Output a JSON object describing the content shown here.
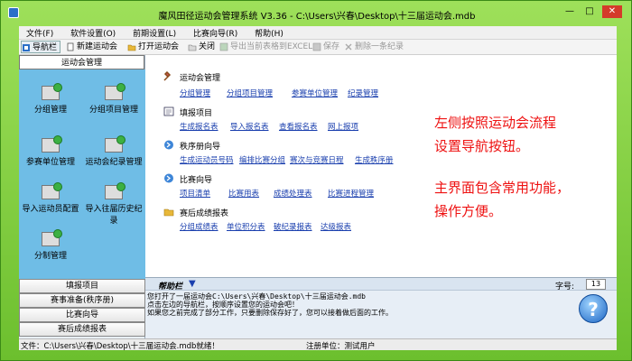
{
  "window": {
    "title": "魔风田径运动会管理系统 V3.36 - C:\\Users\\兴春\\Desktop\\十三届运动会.mdb",
    "minimize": "—",
    "maximize": "□",
    "close": "✕"
  },
  "menu": [
    "文件(F)",
    "软件设置(O)",
    "前期设置(L)",
    "比赛向导(R)",
    "帮助(H)"
  ],
  "toolbar": {
    "nav": "导航栏",
    "new_meet": "新建运动会",
    "open_meet": "打开运动会",
    "close": "关闭",
    "export_excel": "导出当前表格到EXCEL",
    "save": "保存",
    "delete_record": "删除一条纪录"
  },
  "left": {
    "header": "运动会管理",
    "items": [
      "分组管理",
      "分组项目管理",
      "参赛单位管理",
      "运动会纪录管理",
      "导入运动员配置",
      "导入往届历史纪录",
      "分制管理"
    ],
    "buttons": [
      "填报项目",
      "赛事准备(秩序册)",
      "比赛向导",
      "赛后成绩报表"
    ]
  },
  "main": {
    "sections": [
      {
        "title": "运动会管理",
        "icon": "tools-icon",
        "links": [
          "分组管理",
          "分组项目管理",
          "参赛单位管理",
          "纪录管理"
        ]
      },
      {
        "title": "填报项目",
        "icon": "form-icon",
        "links": [
          "生成报名表",
          "导入报名表",
          "查看报名表",
          "网上报项"
        ]
      },
      {
        "title": "秩序册向导",
        "icon": "arrow-circle-icon",
        "links": [
          "生成运动员号码",
          "编排比赛分组",
          "赛次与竞赛日程",
          "生成秩序册"
        ]
      },
      {
        "title": "比赛向导",
        "icon": "arrow-circle-icon",
        "links": [
          "项目清单",
          "比赛用表",
          "成绩处理表",
          "比赛进程管理"
        ]
      },
      {
        "title": "赛后成绩报表",
        "icon": "folder-icon",
        "links": [
          "分组成绩表",
          "单位积分表",
          "破纪录报表",
          "达级报表"
        ]
      }
    ],
    "annotation_line1": "左侧按照运动会流程",
    "annotation_line2": "设置导航按钮。",
    "annotation_line3": "主界面包含常用功能，",
    "annotation_line4": "操作方便。"
  },
  "help": {
    "title": "帮助栏",
    "font_size_label": "字号:",
    "font_size_value": "13",
    "text_line1": "您打开了一届运动会C:\\Users\\兴春\\Desktop\\十三届运动会.mdb",
    "text_line2": "    点击左边的导航栏，按顺序设置您的运动会吧！",
    "text_line3": "    如果您之前完成了部分工作，只要删除保存好了，您可以接着做后面的工作。",
    "help_button": "?"
  },
  "status": {
    "file": "文件：C:\\Users\\兴春\\Desktop\\十三届运动会.mdb就绪！",
    "user": "注册单位：测试用户"
  }
}
